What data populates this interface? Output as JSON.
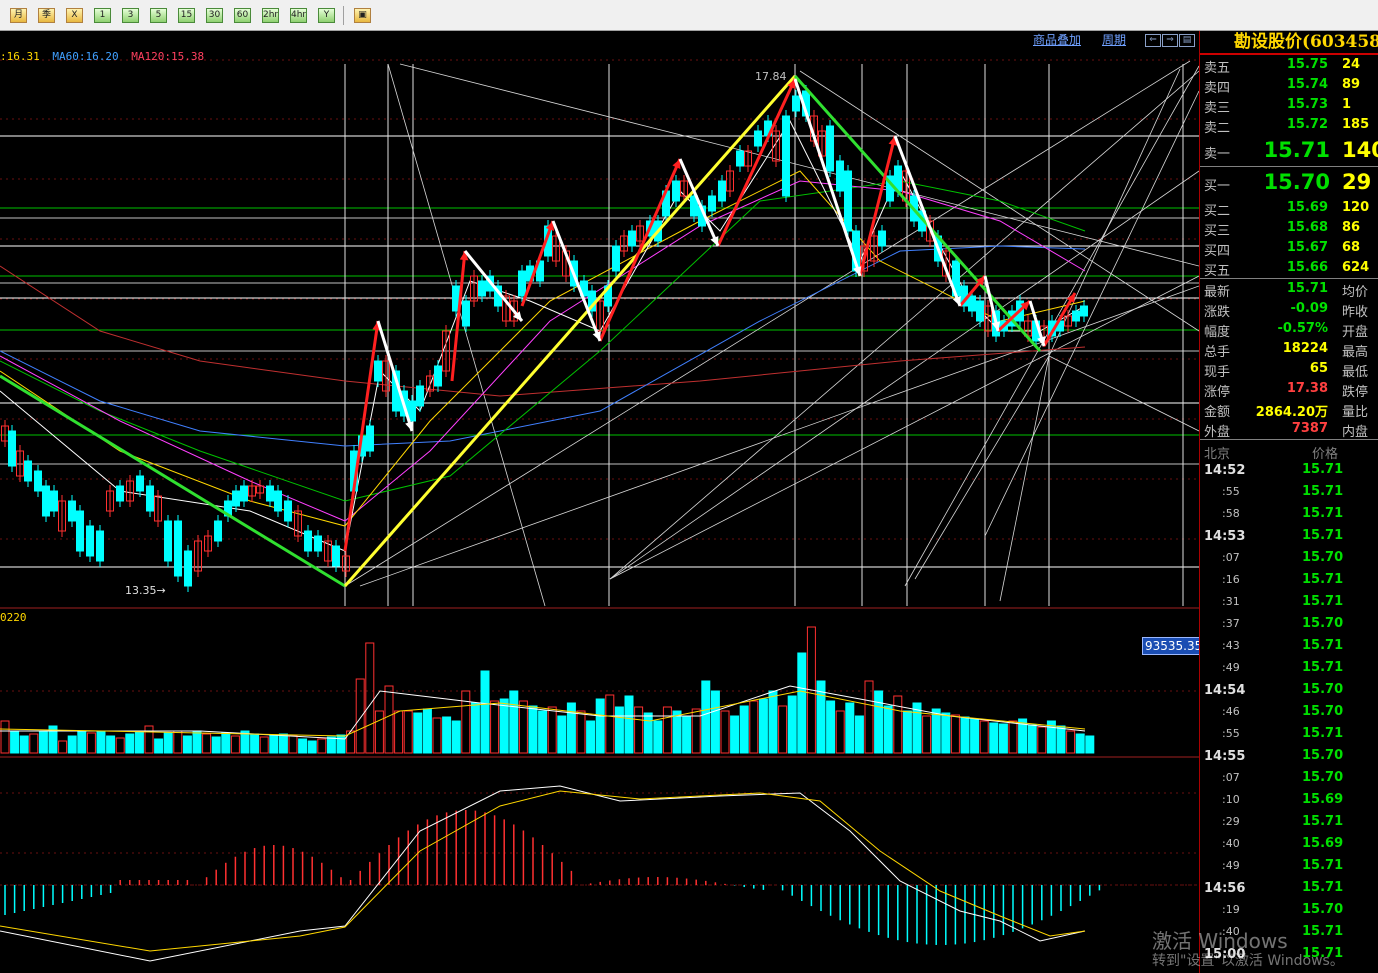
{
  "toolbar": {
    "buttons": [
      "月",
      "季",
      "X",
      "1",
      "3",
      "5",
      "15",
      "30",
      "60",
      "2hr",
      "4hr",
      "Y"
    ],
    "last_button": "▣"
  },
  "chart": {
    "links": {
      "overlay": "商品叠加",
      "period": "周期"
    },
    "ma_legend": {
      "ma_a": ":16.31",
      "ma60": "MA60:16.20",
      "ma120": "MA120:15.38"
    },
    "high_label": "17.84",
    "low_label": "13.35→",
    "volume_label": "0220",
    "volume_value": "93535.35",
    "colors": {
      "up": "#ff3030",
      "down": "#00ffff",
      "ma_white": "#ffffff",
      "ma_yellow": "#ffd700",
      "ma_magenta": "#ff40ff",
      "ma_green": "#00c000",
      "ma_blue": "#4080ff",
      "ma_brown": "#c03030"
    }
  },
  "quote": {
    "title": "勘设股价(603458",
    "asks": [
      {
        "label": "卖五",
        "price": "15.75",
        "qty": "24"
      },
      {
        "label": "卖四",
        "price": "15.74",
        "qty": "89"
      },
      {
        "label": "卖三",
        "price": "15.73",
        "qty": "1"
      },
      {
        "label": "卖二",
        "price": "15.72",
        "qty": "185"
      },
      {
        "label": "卖一",
        "price": "15.71",
        "qty": "140"
      }
    ],
    "bids": [
      {
        "label": "买一",
        "price": "15.70",
        "qty": "29"
      },
      {
        "label": "买二",
        "price": "15.69",
        "qty": "120"
      },
      {
        "label": "买三",
        "price": "15.68",
        "qty": "86"
      },
      {
        "label": "买四",
        "price": "15.67",
        "qty": "68"
      },
      {
        "label": "买五",
        "price": "15.66",
        "qty": "624"
      }
    ],
    "stats": [
      {
        "label": "最新",
        "value": "15.71",
        "label2": "均价",
        "style": ""
      },
      {
        "label": "涨跌",
        "value": "-0.09",
        "label2": "昨收",
        "style": ""
      },
      {
        "label": "幅度",
        "value": "-0.57%",
        "label2": "开盘",
        "style": ""
      },
      {
        "label": "总手",
        "value": "18224",
        "label2": "最高",
        "style": "yellow"
      },
      {
        "label": "现手",
        "value": "65",
        "label2": "最低",
        "style": "yellow"
      },
      {
        "label": "涨停",
        "value": "17.38",
        "label2": "跌停",
        "style": "red"
      },
      {
        "label": "金额",
        "value": "2864.20万",
        "label2": "量比",
        "style": "yellow"
      },
      {
        "label": "外盘",
        "value": "7387",
        "label2": "内盘",
        "style": "red"
      }
    ],
    "ticks_header": {
      "left": "北京",
      "right": "价格"
    },
    "ticks": [
      {
        "time": "14:52",
        "major": true,
        "price": "15.71"
      },
      {
        "time": ":55",
        "major": false,
        "price": "15.71"
      },
      {
        "time": ":58",
        "major": false,
        "price": "15.71"
      },
      {
        "time": "14:53",
        "major": true,
        "price": "15.71"
      },
      {
        "time": ":07",
        "major": false,
        "price": "15.70"
      },
      {
        "time": ":16",
        "major": false,
        "price": "15.71"
      },
      {
        "time": ":31",
        "major": false,
        "price": "15.71"
      },
      {
        "time": ":37",
        "major": false,
        "price": "15.70"
      },
      {
        "time": ":43",
        "major": false,
        "price": "15.71"
      },
      {
        "time": ":49",
        "major": false,
        "price": "15.71"
      },
      {
        "time": "14:54",
        "major": true,
        "price": "15.70"
      },
      {
        "time": ":46",
        "major": false,
        "price": "15.70"
      },
      {
        "time": ":55",
        "major": false,
        "price": "15.71"
      },
      {
        "time": "14:55",
        "major": true,
        "price": "15.70"
      },
      {
        "time": ":07",
        "major": false,
        "price": "15.70"
      },
      {
        "time": ":10",
        "major": false,
        "price": "15.69"
      },
      {
        "time": ":29",
        "major": false,
        "price": "15.71"
      },
      {
        "time": ":40",
        "major": false,
        "price": "15.69"
      },
      {
        "time": ":49",
        "major": false,
        "price": "15.71"
      },
      {
        "time": "14:56",
        "major": true,
        "price": "15.71"
      },
      {
        "time": ":19",
        "major": false,
        "price": "15.70"
      },
      {
        "time": ":40",
        "major": false,
        "price": "15.71"
      },
      {
        "time": "15:00",
        "major": true,
        "price": "15.71"
      }
    ]
  },
  "watermark": {
    "line1": "激活 Windows",
    "line2": "转到\"设置\"以激活 Windows。"
  }
}
